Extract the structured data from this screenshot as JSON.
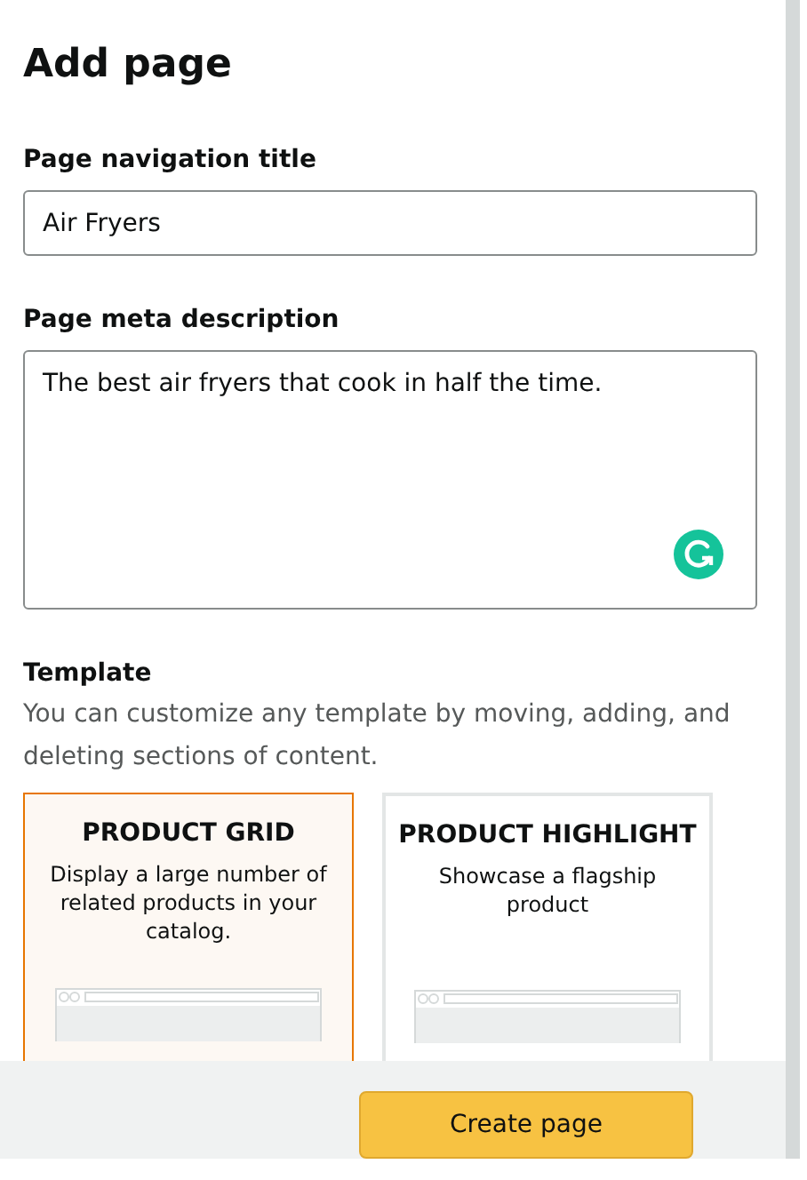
{
  "title": "Add page",
  "fields": [
    {
      "label": "Page navigation title",
      "value": "Air Fryers",
      "kind": "text"
    },
    {
      "label": "Page meta description",
      "value": "The best air fryers that cook in half the time.",
      "kind": "textarea"
    }
  ],
  "template": {
    "label": "Template",
    "hint": "You can customize any template by moving, adding, and deleting sections of content.",
    "options": [
      {
        "title": "PRODUCT GRID",
        "description": "Display a large number of related products in your catalog.",
        "selected": true
      },
      {
        "title": "PRODUCT HIGHLIGHT",
        "description": "Showcase a flagship product",
        "selected": false
      }
    ]
  },
  "footer": {
    "button": "Create page"
  }
}
